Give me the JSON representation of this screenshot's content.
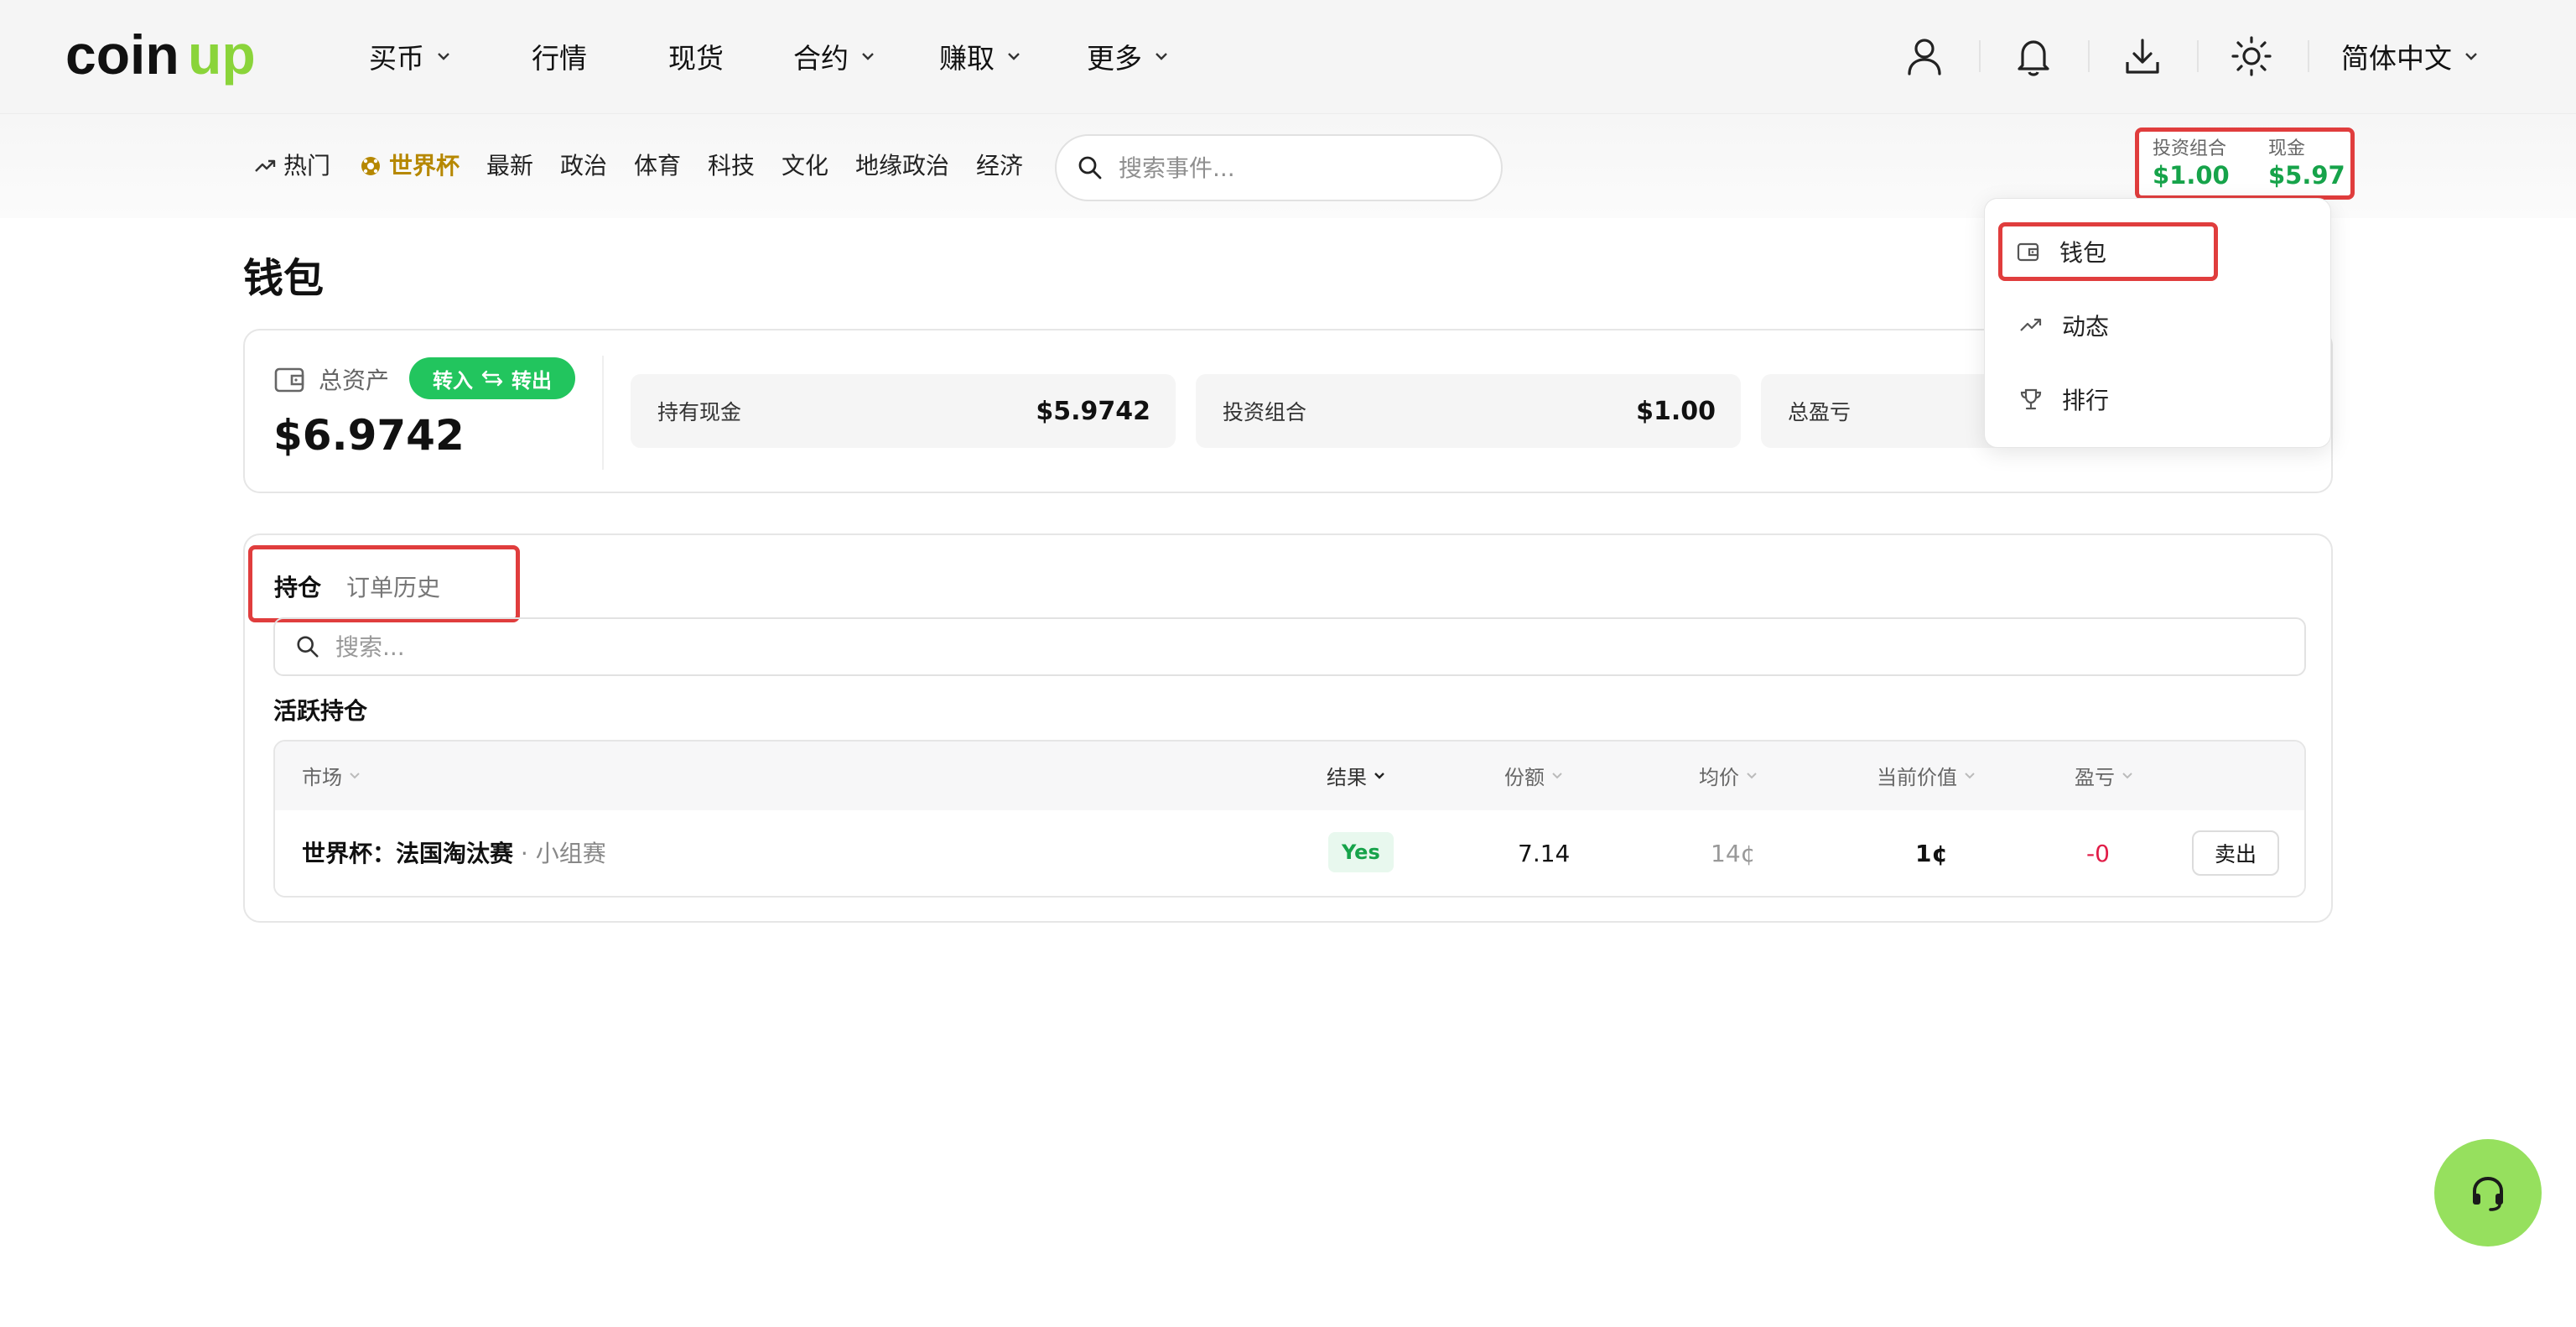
{
  "brand": {
    "logo_text": "coinup",
    "accent": "#22c55e",
    "logo_accent": "#8ad43a"
  },
  "topnav": {
    "items": [
      {
        "label": "买币",
        "has_dropdown": true
      },
      {
        "label": "行情",
        "has_dropdown": false
      },
      {
        "label": "现货",
        "has_dropdown": false
      },
      {
        "label": "合约",
        "has_dropdown": true
      },
      {
        "label": "赚取",
        "has_dropdown": true
      },
      {
        "label": "更多",
        "has_dropdown": true
      }
    ],
    "icons": [
      "user-icon",
      "bell-icon",
      "download-icon",
      "sun-icon"
    ],
    "language": "简体中文"
  },
  "subnav": {
    "categories": [
      {
        "label": "热门",
        "icon": "trending-icon"
      },
      {
        "label": "世界杯",
        "icon": "soccer-ball-icon",
        "active": true
      },
      {
        "label": "最新"
      },
      {
        "label": "政治"
      },
      {
        "label": "体育"
      },
      {
        "label": "科技"
      },
      {
        "label": "文化"
      },
      {
        "label": "地缘政治"
      },
      {
        "label": "经济"
      }
    ],
    "search_placeholder": "搜索事件..."
  },
  "balance": {
    "portfolio_label": "投资组合",
    "portfolio_value": "$1.00",
    "cash_label": "现金",
    "cash_value": "$5.97"
  },
  "dropdown_menu": {
    "items": [
      {
        "label": "钱包",
        "icon": "wallet-icon",
        "highlighted": true
      },
      {
        "label": "动态",
        "icon": "trending-icon"
      },
      {
        "label": "排行",
        "icon": "trophy-icon"
      }
    ]
  },
  "page": {
    "title": "钱包"
  },
  "assets": {
    "total_label": "总资产",
    "transfer_in": "转入",
    "transfer_out": "转出",
    "total_value": "$6.9742",
    "stats": [
      {
        "label": "持有现金",
        "value": "$5.9742"
      },
      {
        "label": "投资组合",
        "value": "$1.00"
      },
      {
        "label": "总盈亏",
        "value": ""
      }
    ]
  },
  "positions": {
    "tabs": [
      {
        "label": "持仓",
        "active": true
      },
      {
        "label": "订单历史",
        "active": false
      }
    ],
    "search_placeholder": "搜索...",
    "section_title": "活跃持仓",
    "columns": [
      "市场",
      "结果",
      "份额",
      "均价",
      "当前价值",
      "盈亏"
    ],
    "rows": [
      {
        "market": "世界杯：法国淘汰赛",
        "market_sub": " · 小组赛",
        "outcome": "Yes",
        "shares": "7.14",
        "avg_price": "14¢",
        "current_value": "1¢",
        "pnl": "-0",
        "action": "卖出"
      }
    ]
  },
  "colors": {
    "profit": "#16a34a",
    "loss": "#e11d48",
    "highlight_border": "#e03d3d",
    "support": "#96e05e"
  }
}
